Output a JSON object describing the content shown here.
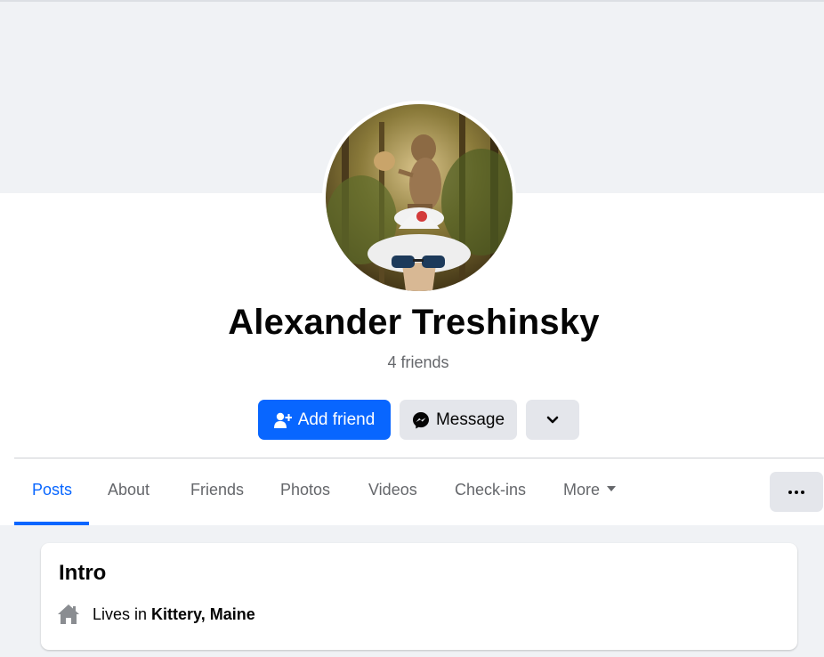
{
  "profile": {
    "name": "Alexander Treshinsky",
    "friends_count": "4 friends"
  },
  "actions": {
    "add_friend": "Add friend",
    "message": "Message",
    "expand_icon": "chevron-down-icon"
  },
  "tabs": [
    {
      "label": "Posts",
      "active": true
    },
    {
      "label": "About"
    },
    {
      "label": "Friends"
    },
    {
      "label": "Photos"
    },
    {
      "label": "Videos"
    },
    {
      "label": "Check-ins"
    },
    {
      "label": "More"
    }
  ],
  "intro": {
    "title": "Intro",
    "lives_prefix": "Lives in",
    "lives_place": "Kittery, Maine"
  },
  "colors": {
    "accent": "#0866ff",
    "secondary_button": "#e4e6eb",
    "page_background": "#f0f2f5",
    "muted_text": "#65676b"
  }
}
